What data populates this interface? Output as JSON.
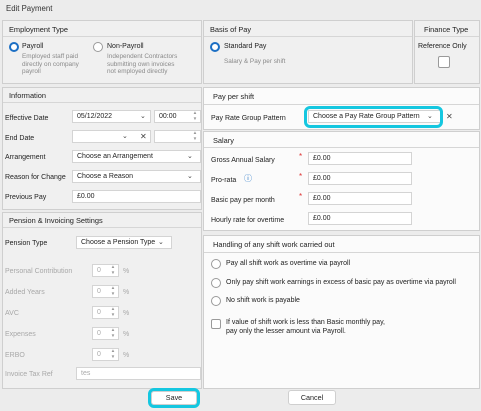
{
  "window": {
    "title": "Edit Payment"
  },
  "employment_type": {
    "title": "Employment Type",
    "payroll": {
      "label": "Payroll",
      "desc": [
        "Employed staff paid",
        "directly on company",
        "payroll"
      ]
    },
    "non_payroll": {
      "label": "Non-Payroll",
      "desc": [
        "Independent Contractors",
        "submitting own invoices",
        "not employed directly"
      ]
    }
  },
  "basis_of_pay": {
    "title": "Basis of Pay",
    "standard_pay": {
      "label": "Standard Pay",
      "desc": "Salary & Pay per shift"
    }
  },
  "finance_type": {
    "title": "Finance Type",
    "reference_only": "Reference Only"
  },
  "information": {
    "title": "Information",
    "effective_date": {
      "label": "Effective Date",
      "value": "05/12/2022",
      "time": "00:00"
    },
    "end_date": {
      "label": "End Date"
    },
    "arrangement": {
      "label": "Arrangement",
      "value": "Choose an Arrangement"
    },
    "reason": {
      "label": "Reason for Change",
      "value": "Choose a Reason"
    },
    "previous_pay": {
      "label": "Previous Pay",
      "value": "£0.00"
    }
  },
  "pension": {
    "title": "Pension & Invoicing Settings",
    "pension_type": {
      "label": "Pension Type",
      "value": "Choose a Pension Type"
    },
    "rows": [
      {
        "label": "Personal Contribution",
        "value": "0"
      },
      {
        "label": "Added Years",
        "value": "0"
      },
      {
        "label": "AVC",
        "value": "0"
      },
      {
        "label": "Expenses",
        "value": "0"
      },
      {
        "label": "ERBO",
        "value": "0"
      }
    ],
    "percent": "%",
    "invoice_tax_ref": {
      "label": "Invoice Tax Ref",
      "value": "tes"
    }
  },
  "pay_per_shift": {
    "title": "Pay per shift",
    "pattern": {
      "label": "Pay Rate Group Pattern",
      "value": "Choose a Pay Rate Group Pattern"
    }
  },
  "salary": {
    "title": "Salary",
    "gross_annual": {
      "label": "Gross Annual Salary",
      "value": "£0.00"
    },
    "pro_rata": {
      "label": "Pro-rata",
      "value": "£0.00"
    },
    "basic_per_month": {
      "label": "Basic pay per month",
      "value": "£0.00"
    },
    "hourly_overtime": {
      "label": "Hourly rate for overtime",
      "value": "£0.00"
    }
  },
  "shift_handling": {
    "title": "Handling of any shift work carried out",
    "options": [
      "Pay all shift work as overtime via payroll",
      "Only pay shift work earnings in excess of basic pay as overtime via payroll",
      "No shift work is payable"
    ],
    "lesser_check": [
      "If value of shift work is less than Basic monthly pay,",
      "pay only the lesser amount via Payroll."
    ]
  },
  "footer": {
    "save": "Save",
    "cancel": "Cancel"
  },
  "colors": {
    "accent": "#1c6fc4",
    "highlight": "#15c7e0",
    "required": "#dd3333"
  },
  "icons": {
    "info": "info-icon",
    "close": "close-icon",
    "chevron": "chevron-down-icon"
  }
}
